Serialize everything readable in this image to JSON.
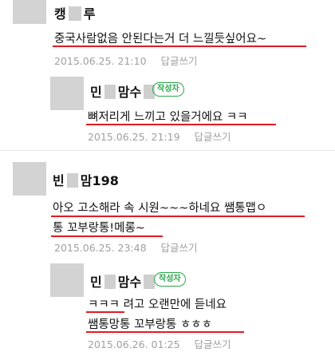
{
  "comments": [
    {
      "author": "캥루",
      "author_parts": [
        "캥",
        "루"
      ],
      "text_lines": [
        "중국사람없음 안된다는거 더 느낄듯싶어요~"
      ],
      "date": "2015.06.25. 21:10",
      "reply_label": "답글쓰기"
    },
    {
      "author": "민맘수",
      "author_parts": [
        "민",
        "맘수"
      ],
      "badge": "작성자",
      "text_lines": [
        "뼈저리게 느끼고 있을거에요 ㅋㅋ"
      ],
      "date": "2015.06.25. 21:19",
      "reply_label": "답글쓰기"
    },
    {
      "author": "빈맘198",
      "author_parts": [
        "빈",
        "맘198"
      ],
      "text_lines": [
        "아오 고소해라 속 시원~~~하네요 쌤통맵ㅇ",
        "통 꼬부랑통!메롱~"
      ],
      "date": "2015.06.25. 23:48",
      "reply_label": "답글쓰기"
    },
    {
      "author": "민맘수",
      "author_parts": [
        "민",
        "맘수"
      ],
      "badge": "작성자",
      "text_lines": [
        "ㅋㅋㅋ 려고 오랜만에 듣네요",
        "쌤통망통 꼬부랑통 ㅎㅎㅎ"
      ],
      "date": "2015.06.26. 01:25",
      "reply_label": "답글쓰기"
    }
  ],
  "colors": {
    "underline": "#e21b23",
    "badge_green": "#2aa84a",
    "meta_grey": "#a0a0a0",
    "avatar_placeholder": "#d3d3d3"
  }
}
